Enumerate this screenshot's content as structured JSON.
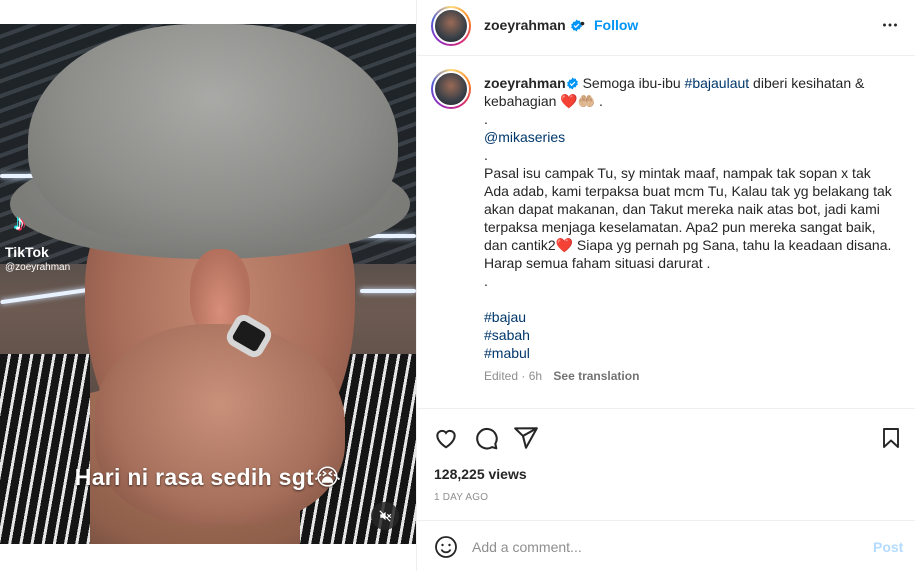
{
  "video": {
    "watermark_brand": "TikTok",
    "watermark_handle": "@zoeyrahman",
    "caption_text": "Hari ni rasa sedih sgt😭",
    "mute_icon": "speaker-muted-icon"
  },
  "header": {
    "username": "zoeyrahman",
    "separator": "•",
    "follow_label": "Follow",
    "more_icon": "more-horizontal-icon"
  },
  "caption": {
    "username": "zoeyrahman",
    "lines": [
      {
        "pre": " Semoga ibu-ibu ",
        "tag": "#bajaulaut",
        "post": " diberi kesihatan &"
      },
      {
        "text": "kebahagian ❤️🤲🏼 ."
      },
      {
        "text": "."
      },
      {
        "tag": "@mikaseries"
      },
      {
        "text": "."
      },
      {
        "text": "Pasal isu campak Tu, sy mintak maaf, nampak tak sopan x tak"
      },
      {
        "text": "Ada adab, kami terpaksa buat mcm Tu, Kalau tak yg belakang tak"
      },
      {
        "text": "akan dapat makanan, dan Takut mereka naik atas bot, jadi kami"
      },
      {
        "text": "terpaksa menjaga keselamatan. Apa2 pun mereka sangat baik,"
      },
      {
        "text": "dan cantik2❤️ Siapa yg pernah pg Sana, tahu la keadaan disana."
      },
      {
        "text": "Harap semua faham situasi darurat ."
      },
      {
        "text": "."
      },
      {
        "text": ""
      },
      {
        "tag": "#bajau"
      },
      {
        "tag": "#sabah"
      },
      {
        "tag": "#mabul"
      }
    ],
    "edited": "Edited · 6h",
    "see_translation": "See translation"
  },
  "actions": {
    "views": "128,225 views",
    "date": "1 DAY AGO"
  },
  "add_comment": {
    "placeholder": "Add a comment...",
    "post_label": "Post"
  },
  "colors": {
    "accent": "#0095f6",
    "hashtag": "#00376b",
    "post_disabled": "#b3dbff",
    "muted_text": "#8e8e8e"
  }
}
